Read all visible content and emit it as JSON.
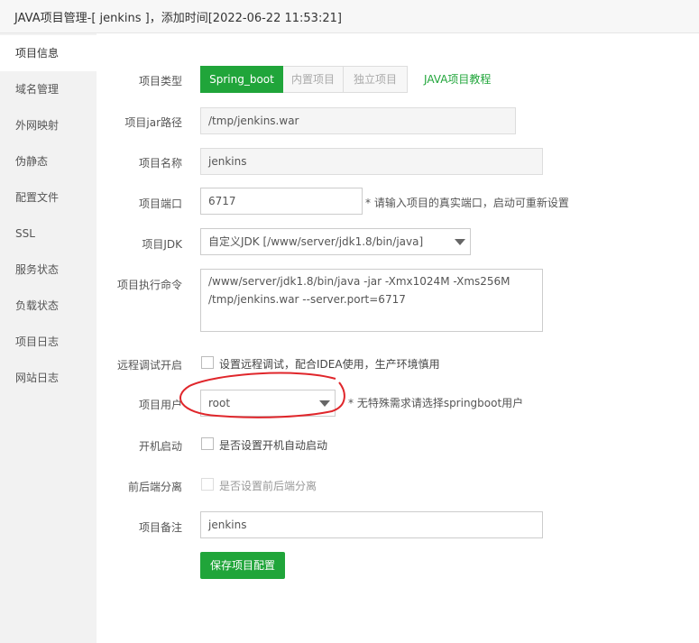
{
  "window": {
    "title": "JAVA项目管理-[ jenkins ]，添加时间[2022-06-22 11:53:21]"
  },
  "sidebar": {
    "items": [
      {
        "label": "项目信息",
        "active": true
      },
      {
        "label": "域名管理"
      },
      {
        "label": "外网映射"
      },
      {
        "label": "伪静态"
      },
      {
        "label": "配置文件"
      },
      {
        "label": "SSL"
      },
      {
        "label": "服务状态"
      },
      {
        "label": "负载状态"
      },
      {
        "label": "项目日志"
      },
      {
        "label": "网站日志"
      }
    ]
  },
  "form": {
    "type": {
      "label": "项目类型",
      "options": [
        "Spring_boot",
        "内置项目",
        "独立项目"
      ],
      "selected": "Spring_boot",
      "tutorial_link": "JAVA项目教程"
    },
    "jar_path": {
      "label": "项目jar路径",
      "value": "/tmp/jenkins.war"
    },
    "name": {
      "label": "项目名称",
      "value": "jenkins"
    },
    "port": {
      "label": "项目端口",
      "value": "6717",
      "hint": "* 请输入项目的真实端口，启动可重新设置"
    },
    "jdk": {
      "label": "项目JDK",
      "value": "自定义JDK [/www/server/jdk1.8/bin/java]"
    },
    "command": {
      "label": "项目执行命令",
      "value": "/www/server/jdk1.8/bin/java -jar -Xmx1024M -Xms256M /tmp/jenkins.war --server.port=6717"
    },
    "remote_debug": {
      "label": "远程调试开启",
      "text": "设置远程调试，配合IDEA使用，生产环境慎用",
      "checked": false
    },
    "user": {
      "label": "项目用户",
      "value": "root",
      "hint": "* 无特殊需求请选择springboot用户"
    },
    "autostart": {
      "label": "开机启动",
      "text": "是否设置开机自动启动",
      "checked": false
    },
    "separation": {
      "label": "前后端分离",
      "text": "是否设置前后端分离",
      "checked": false,
      "disabled": true
    },
    "remark": {
      "label": "项目备注",
      "value": "jenkins"
    },
    "save_label": "保存项目配置"
  },
  "annotation": {
    "color": "#e0262b"
  },
  "colors": {
    "accent": "#20a53a",
    "sidebar_bg": "#f2f2f2"
  }
}
